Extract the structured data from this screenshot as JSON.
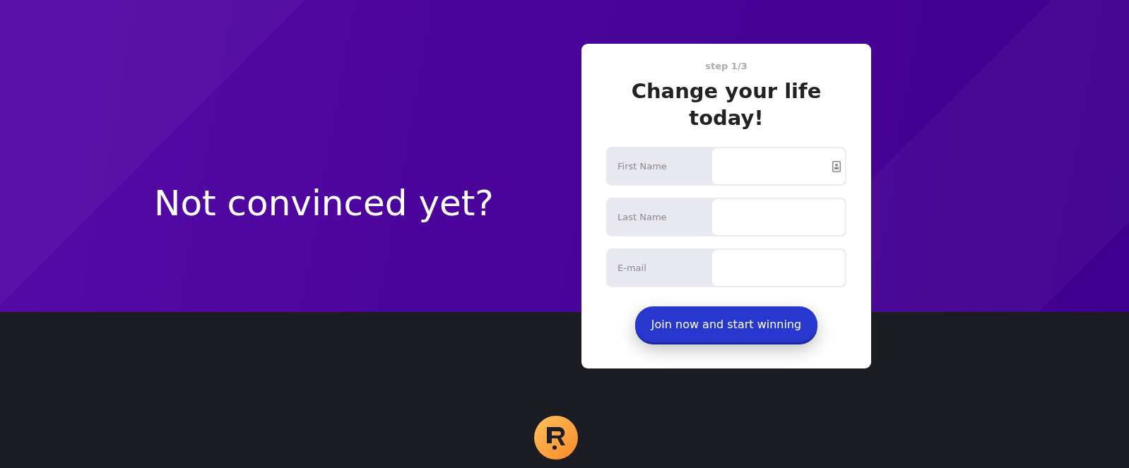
{
  "hero": {
    "heading": "Not convinced yet?"
  },
  "form": {
    "step": "step 1/3",
    "title": "Change your life today!",
    "fields": [
      {
        "label": "First Name",
        "autofill_icon": true
      },
      {
        "label": "Last Name",
        "autofill_icon": false
      },
      {
        "label": "E-mail",
        "autofill_icon": false
      }
    ],
    "submit": "Join now and start winning"
  }
}
